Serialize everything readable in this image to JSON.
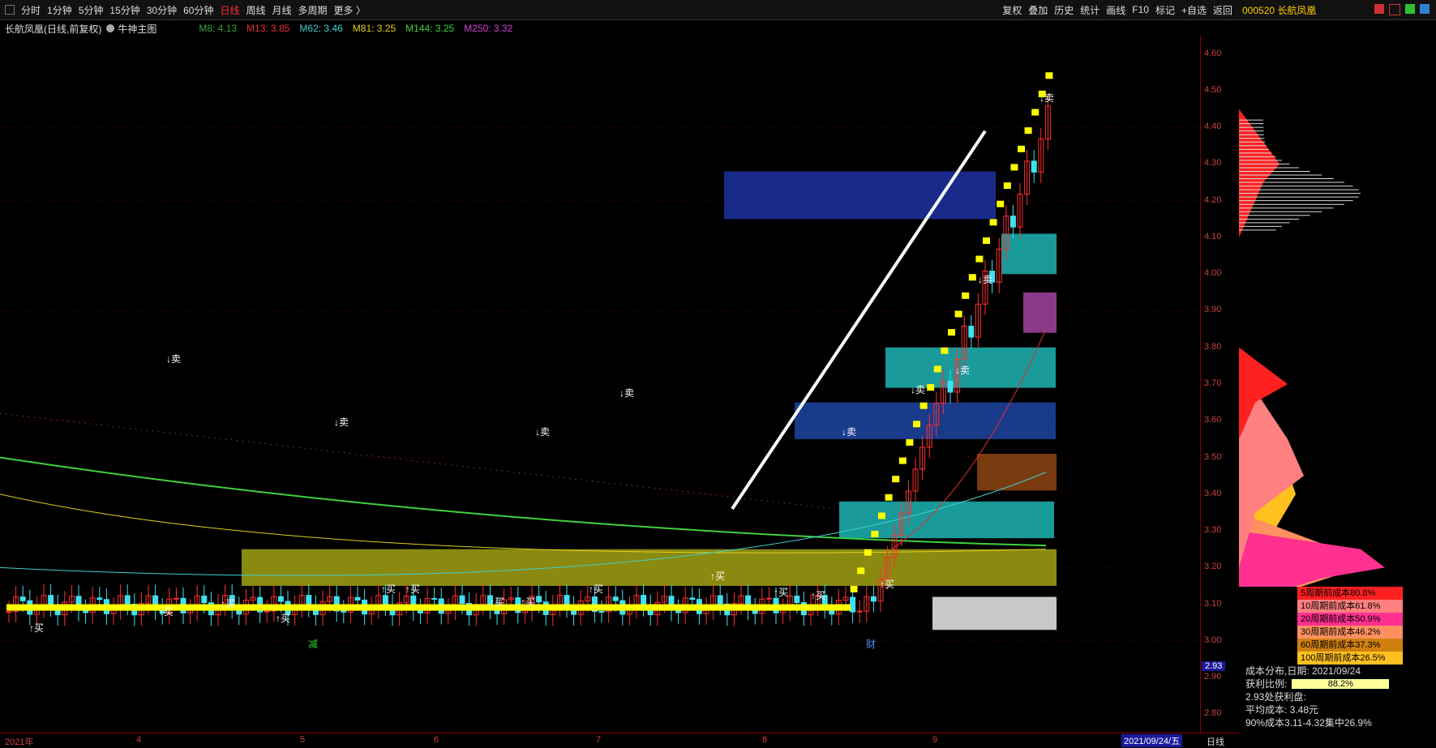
{
  "toolbar": {
    "left_items": [
      {
        "label": "分时",
        "active": false
      },
      {
        "label": "1分钟",
        "active": false
      },
      {
        "label": "5分钟",
        "active": false
      },
      {
        "label": "15分钟",
        "active": false
      },
      {
        "label": "30分钟",
        "active": false
      },
      {
        "label": "60分钟",
        "active": false
      },
      {
        "label": "日线",
        "active": true
      },
      {
        "label": "周线",
        "active": false
      },
      {
        "label": "月线",
        "active": false
      },
      {
        "label": "多周期",
        "active": false
      },
      {
        "label": "更多 〉",
        "active": false
      }
    ],
    "right_items": [
      "复权",
      "叠加",
      "历史",
      "统计",
      "画线",
      "F10",
      "标记",
      "+自选",
      "返回"
    ]
  },
  "stock": {
    "code_name": "000520 长航凤凰"
  },
  "info": {
    "title": "长航凤凰(日线,前复权)",
    "indicator": "牛神主图",
    "mas": [
      {
        "label": "M8: 4.13",
        "color": "#3aa43a"
      },
      {
        "label": "M13: 3.85",
        "color": "#e03030"
      },
      {
        "label": "M62: 3.46",
        "color": "#40d0d0"
      },
      {
        "label": "M81: 3.25",
        "color": "#e0d020"
      },
      {
        "label": "M144: 3.25",
        "color": "#40d040"
      },
      {
        "label": "M250: 3.32",
        "color": "#d040d0"
      }
    ]
  },
  "price_axis": [
    "4.60",
    "4.50",
    "4.40",
    "4.30",
    "4.20",
    "4.10",
    "4.00",
    "3.90",
    "3.80",
    "3.70",
    "3.60",
    "3.50",
    "3.40",
    "3.30",
    "3.20",
    "3.10",
    "3.00",
    "2.90",
    "2.80"
  ],
  "current_price": "2.93",
  "date_axis": [
    {
      "label": "2021年"
    },
    {
      "label": "4"
    },
    {
      "label": "5"
    },
    {
      "label": "6"
    },
    {
      "label": "7"
    },
    {
      "label": "8"
    },
    {
      "label": "9"
    }
  ],
  "current_date": "2021/09/24/五",
  "period_label": "日线",
  "markers": {
    "buy": "↑买",
    "sell": "↓卖",
    "reduce": "减",
    "finance": "财"
  },
  "legend": [
    {
      "label": "5周期前成本80.8%",
      "color": "#ff2020"
    },
    {
      "label": "10周期前成本61.8%",
      "color": "#ff8080"
    },
    {
      "label": "20周期前成本50.9%",
      "color": "#ff3090"
    },
    {
      "label": "30周期前成本46.2%",
      "color": "#ff9060"
    },
    {
      "label": "60周期前成本37.3%",
      "color": "#d08010"
    },
    {
      "label": "100周期前成本26.5%",
      "color": "#ffc020"
    }
  ],
  "cost_info": {
    "date_line": "成本分布,日期: 2021/09/24",
    "profit_label": "获利比例:",
    "profit_value": "88.2%",
    "profit_ratio": 0.882,
    "line1": "2.93处获利盘:",
    "line2": "平均成本: 3.48元",
    "line3": "90%成本3.11-4.32集中26.9%"
  },
  "colors": {
    "up": "#ff3030",
    "down": "#40e0f0",
    "axis": "#8b0000",
    "trend_yellow": "#ffff00"
  }
}
